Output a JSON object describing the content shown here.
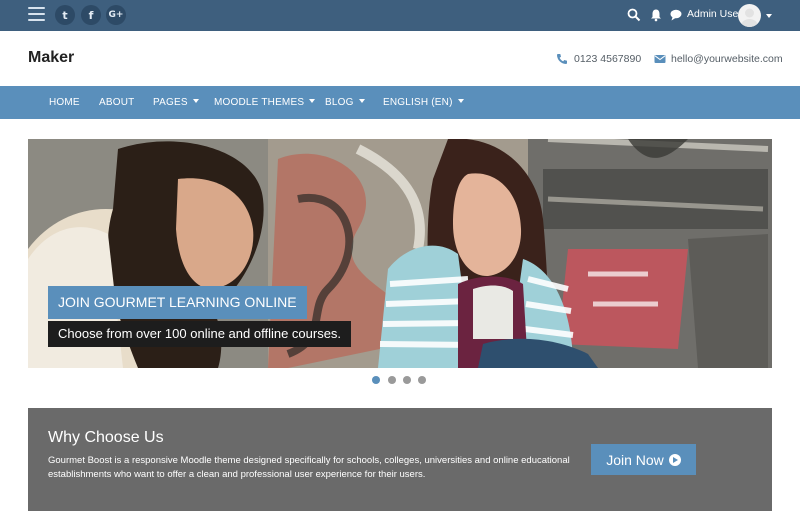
{
  "topbar": {
    "social": [
      {
        "name": "twitter-icon",
        "glyph": "t"
      },
      {
        "name": "facebook-icon",
        "glyph": "f"
      },
      {
        "name": "google-plus-icon",
        "glyph": "G+"
      }
    ],
    "user_name": "Admin User"
  },
  "header": {
    "brand": "Maker",
    "phone": "0123 4567890",
    "email": "hello@yourwebsite.com"
  },
  "nav": {
    "items": [
      {
        "label": "HOME",
        "dropdown": false
      },
      {
        "label": "ABOUT",
        "dropdown": false
      },
      {
        "label": "PAGES",
        "dropdown": true
      },
      {
        "label": "MOODLE THEMES",
        "dropdown": true
      },
      {
        "label": "BLOG",
        "dropdown": true
      },
      {
        "label": "ENGLISH (EN)",
        "dropdown": true
      }
    ]
  },
  "slider": {
    "caption_title": "JOIN GOURMET LEARNING ONLINE",
    "caption_text": "Choose from over 100 online and offline courses.",
    "dot_count": 4,
    "active_dot": 1
  },
  "why": {
    "title": "Why Choose Us",
    "text": "Gourmet Boost is a responsive Moodle theme designed specifically for schools, colleges, universities and online educational establishments who want to offer a clean and professional user experience for their users.",
    "button": "Join Now"
  },
  "colors": {
    "topbar": "#3e5f7e",
    "accent": "#5a8fbb",
    "panel": "#6a6a6a"
  }
}
